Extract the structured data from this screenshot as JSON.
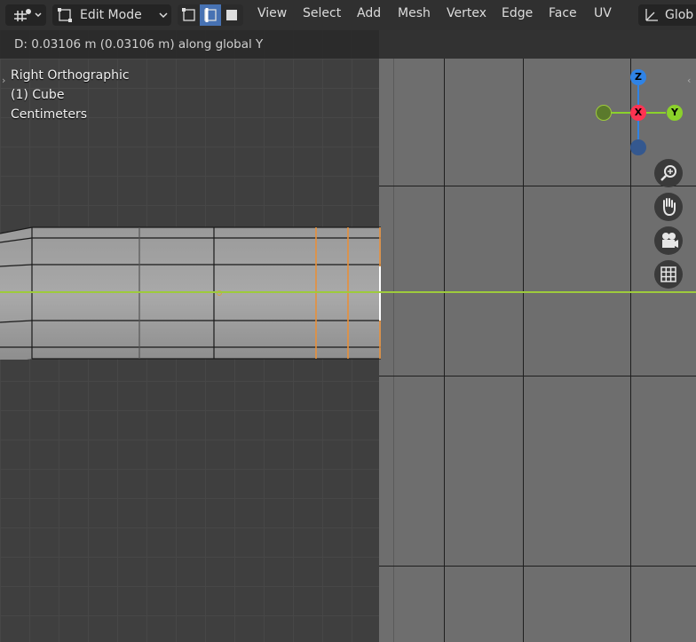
{
  "header": {
    "mode_label": "Edit Mode",
    "menus": [
      "View",
      "Select",
      "Add",
      "Mesh",
      "Vertex",
      "Edge",
      "Face",
      "UV"
    ],
    "transform_orientation": "Glob"
  },
  "status": {
    "text": "D: 0.03106 m (0.03106 m) along global Y"
  },
  "viewport_info": {
    "view_name": "Right Orthographic",
    "object": "(1) Cube",
    "units": "Centimeters"
  },
  "gizmo": {
    "z_label": "Z",
    "x_label": "X",
    "y_label": "Y",
    "colors": {
      "x": "#ff3352",
      "y": "#8bd12b",
      "z": "#2f83e6",
      "y_neg": "#5b7a2c",
      "z_neg": "#34588f"
    }
  },
  "tools": [
    "zoom-icon",
    "hand-pan-icon",
    "camera-icon",
    "grid-icon"
  ]
}
